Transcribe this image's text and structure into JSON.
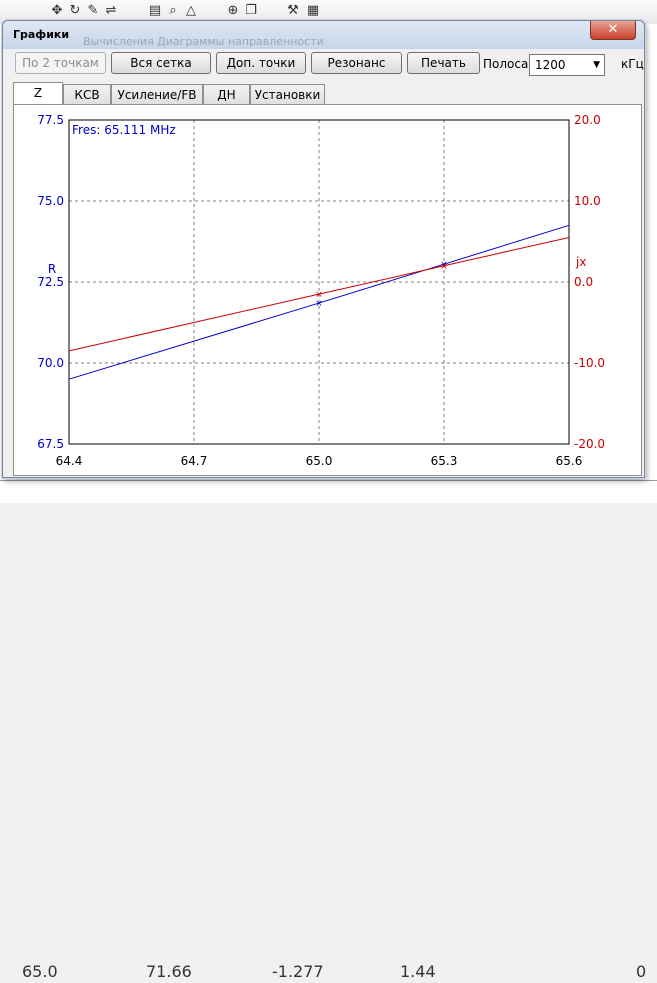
{
  "window": {
    "title": "Графики",
    "behind_title": "Вычисления    Диаграммы направленности"
  },
  "toolbar": {
    "by_two_points": "По 2 точкам",
    "full_grid": "Вся сетка",
    "extra_points": "Доп. точки",
    "resonance": "Резонанс",
    "print": "Печать",
    "band_label": "Полоса",
    "band_value": "1200",
    "band_unit": "кГц"
  },
  "tabs": [
    "Z",
    "КСВ",
    "Усиление/FB",
    "ДН",
    "Установки"
  ],
  "colors": {
    "r_series": "#0000cc",
    "jx_series": "#cc0000",
    "grid": "#808080"
  },
  "background_table": {
    "cells": [
      "65.0",
      "71.66",
      "-1.277",
      "1.44",
      "0"
    ]
  },
  "chart_data": {
    "type": "line",
    "annotation": "Fres: 65.111 MHz",
    "x_ticks": [
      "64.4",
      "64.7",
      "65.0",
      "65.3",
      "65.6"
    ],
    "xlim": [
      64.4,
      65.6
    ],
    "y_left": {
      "label": "R",
      "lim": [
        67.5,
        77.5
      ],
      "ticks": [
        "67.5",
        "70.0",
        "72.5",
        "75.0",
        "77.5"
      ]
    },
    "y_right": {
      "label": "jx",
      "lim": [
        -20,
        20
      ],
      "ticks": [
        "-20.0",
        "-10.0",
        "0.0",
        "10.0",
        "20.0"
      ]
    },
    "series": [
      {
        "name": "R",
        "axis": "left",
        "color": "#0000cc",
        "x": [
          64.4,
          65.0,
          65.3,
          65.6
        ],
        "y": [
          69.5,
          71.85,
          73.05,
          74.25
        ],
        "markers_at": [
          65.0,
          65.3
        ]
      },
      {
        "name": "jx",
        "axis": "right",
        "color": "#cc0000",
        "x": [
          64.4,
          65.0,
          65.3,
          65.6
        ],
        "y": [
          -8.5,
          -1.5,
          2.0,
          5.5
        ],
        "markers_at": [
          65.0,
          65.3
        ]
      }
    ]
  }
}
